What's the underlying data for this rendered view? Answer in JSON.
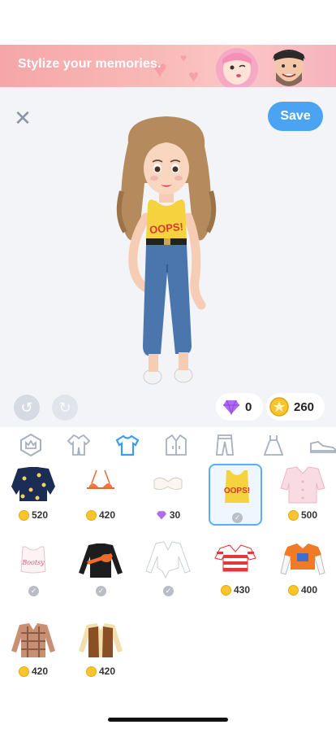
{
  "banner": {
    "text": "Stylize your memories."
  },
  "toolbar": {
    "save_label": "Save"
  },
  "currency": {
    "gems": "0",
    "coins": "260"
  },
  "avatar": {
    "shirt_text": "OOPS!"
  },
  "tabs": [
    {
      "icon": "crown-icon"
    },
    {
      "icon": "jumpsuit-icon"
    },
    {
      "icon": "tshirt-icon",
      "active": true
    },
    {
      "icon": "jacket-icon"
    },
    {
      "icon": "pants-icon"
    },
    {
      "icon": "dress-icon"
    },
    {
      "icon": "sneaker-icon"
    }
  ],
  "items": [
    {
      "name": "floral-jacket",
      "price": "520",
      "currency": "coin"
    },
    {
      "name": "orange-bikini-top",
      "price": "420",
      "currency": "coin"
    },
    {
      "name": "white-bandeau",
      "price": "30",
      "currency": "gem"
    },
    {
      "name": "yellow-oops-tank",
      "price": "",
      "currency": "owned",
      "selected": true,
      "label": "OOPS!"
    },
    {
      "name": "pink-pajama-shirt",
      "price": "500",
      "currency": "coin"
    },
    {
      "name": "white-crop-top",
      "price": "",
      "currency": "owned",
      "label": "Bootsy"
    },
    {
      "name": "black-longsleeve",
      "price": "",
      "currency": "owned"
    },
    {
      "name": "white-tied-blouse",
      "price": "",
      "currency": "owned"
    },
    {
      "name": "striped-crop-top",
      "price": "430",
      "currency": "coin"
    },
    {
      "name": "orange-layered-tee",
      "price": "400",
      "currency": "coin"
    },
    {
      "name": "plaid-shirt",
      "price": "420",
      "currency": "coin"
    },
    {
      "name": "brown-vest",
      "price": "420",
      "currency": "coin"
    }
  ],
  "colors": {
    "accent": "#4ba3f3",
    "selected_border": "#5aaef7",
    "banner": "#f6a6a8"
  }
}
